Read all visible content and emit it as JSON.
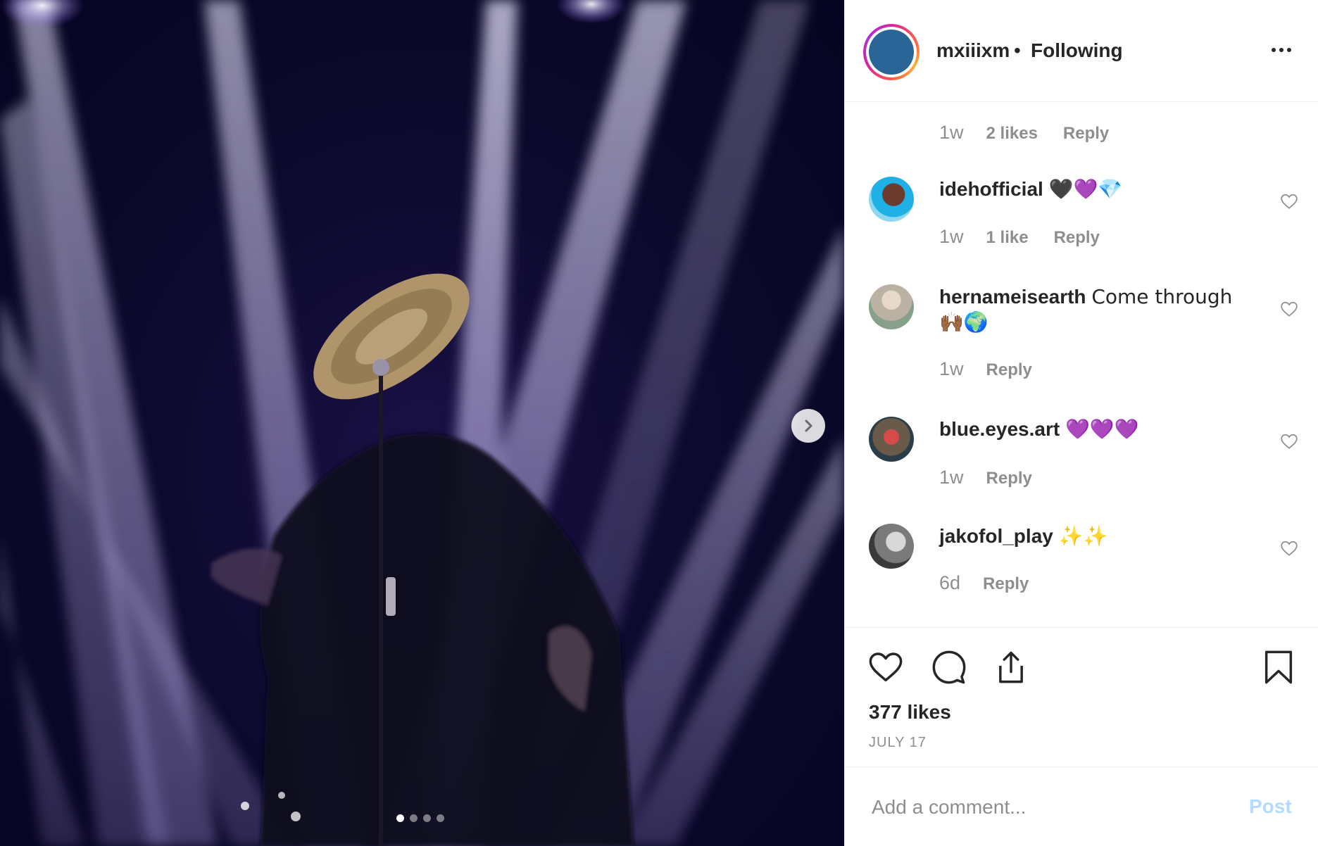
{
  "post": {
    "username": "mxiiixm",
    "separator": "•",
    "follow_status": "Following",
    "carousel": {
      "slide_count": 4,
      "active_index": 0
    }
  },
  "comments": {
    "first_meta": {
      "time": "1w",
      "likes": "2 likes",
      "reply": "Reply"
    },
    "items": [
      {
        "user": "idehofficial",
        "text": "🖤💜💎",
        "time": "1w",
        "likes": "1 like",
        "reply": "Reply"
      },
      {
        "user": "hernameisearth",
        "text": "Come through 🙌🏾🌍",
        "time": "1w",
        "reply": "Reply"
      },
      {
        "user": "blue.eyes.art",
        "text": "💜💜💜",
        "time": "1w",
        "reply": "Reply"
      },
      {
        "user": "jakofol_play",
        "text": "✨✨",
        "time": "6d",
        "reply": "Reply"
      }
    ]
  },
  "actions": {
    "likes": "377 likes",
    "date": "JULY 17"
  },
  "add_comment": {
    "placeholder": "Add a comment...",
    "post_label": "Post"
  },
  "colors": {
    "accent_blue": "#b3dbff",
    "avatar_blue": "#2a6597",
    "muted": "#8e8e8e"
  }
}
